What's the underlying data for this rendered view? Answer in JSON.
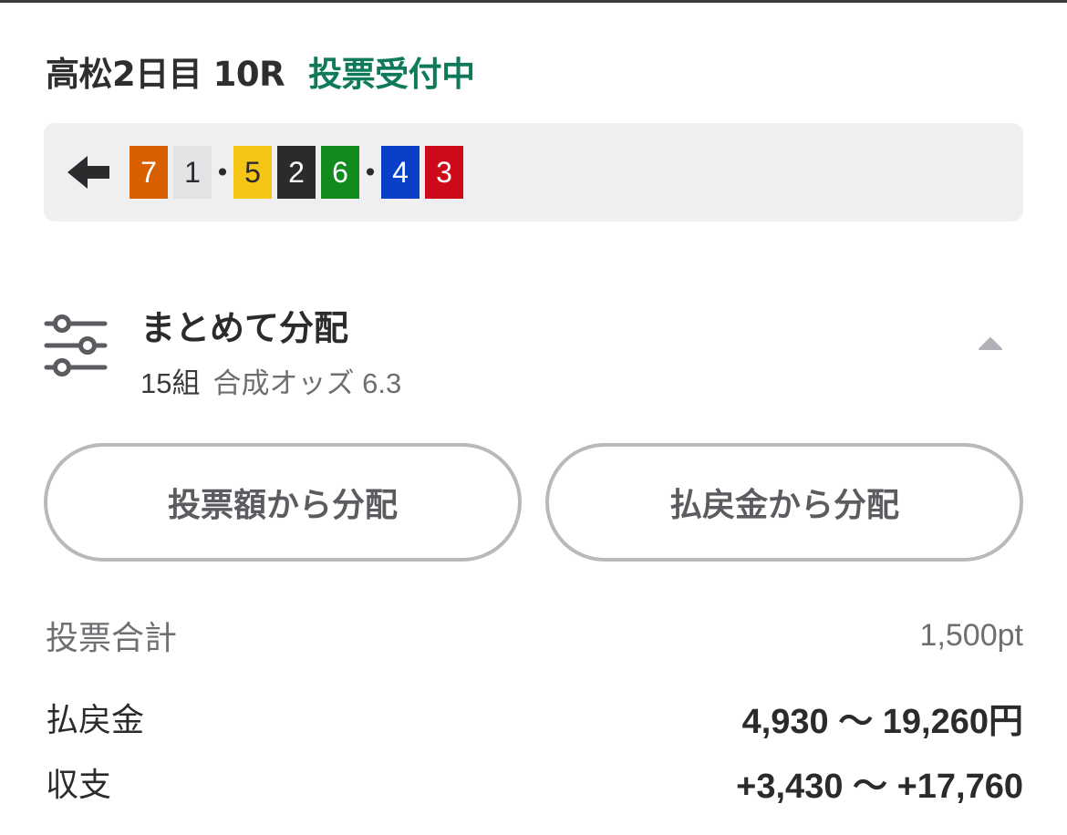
{
  "header": {
    "race_title": "高松2日目 10R",
    "status": "投票受付中",
    "status_color": "#0f7a5a"
  },
  "combo": {
    "icon": "arrow-left-icon",
    "groups": [
      [
        {
          "num": "7",
          "bg": "#d96000",
          "fg": "#ffffff"
        },
        {
          "num": "1",
          "bg": "#e3e3e6",
          "fg": "#2b2b2e"
        }
      ],
      [
        {
          "num": "5",
          "bg": "#f5c515",
          "fg": "#2b2b2e"
        },
        {
          "num": "2",
          "bg": "#2b2b2e",
          "fg": "#ffffff"
        },
        {
          "num": "6",
          "bg": "#138a1e",
          "fg": "#ffffff"
        }
      ],
      [
        {
          "num": "4",
          "bg": "#0a3fc7",
          "fg": "#ffffff"
        },
        {
          "num": "3",
          "bg": "#cc0a1a",
          "fg": "#ffffff"
        }
      ]
    ],
    "separator": "•"
  },
  "distribution": {
    "icon": "sliders-icon",
    "title": "まとめて分配",
    "count": "15組",
    "odds": "合成オッズ 6.3",
    "toggle_icon": "caret-up-icon"
  },
  "buttons": {
    "by_amount": "投票額から分配",
    "by_payout": "払戻金から分配"
  },
  "summary": {
    "total_label": "投票合計",
    "total_value": "1,500pt",
    "payout_label": "払戻金",
    "payout_value": "4,930 〜 19,260円",
    "balance_label": "収支",
    "balance_value": "+3,430 〜 +17,760"
  }
}
